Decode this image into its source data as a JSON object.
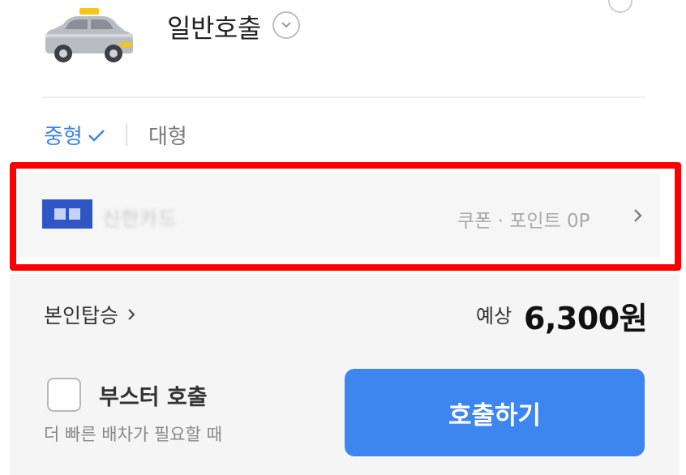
{
  "header": {
    "call_type_label": "일반호출",
    "icons": [
      "taxi-icon",
      "chevron-down-icon"
    ]
  },
  "vehicle_size_tabs": [
    {
      "label": "중형",
      "selected": true
    },
    {
      "label": "대형",
      "selected": false
    }
  ],
  "payment": {
    "card_name": "신한카드",
    "coupon_point_label": "쿠폰 · 포인트 0P",
    "highlighted": true
  },
  "ride_options": {
    "self_ride_label": "본인탑승",
    "estimate_label": "예상",
    "estimate_price": "6,300원"
  },
  "booster": {
    "label": "부스터 호출",
    "description": "더 빠른 배차가 필요할 때",
    "checked": false
  },
  "call_button_label": "호출하기",
  "colors": {
    "accent": "#3d86f0",
    "selected_tab": "#3b82e6",
    "highlight": "#ff0000"
  }
}
